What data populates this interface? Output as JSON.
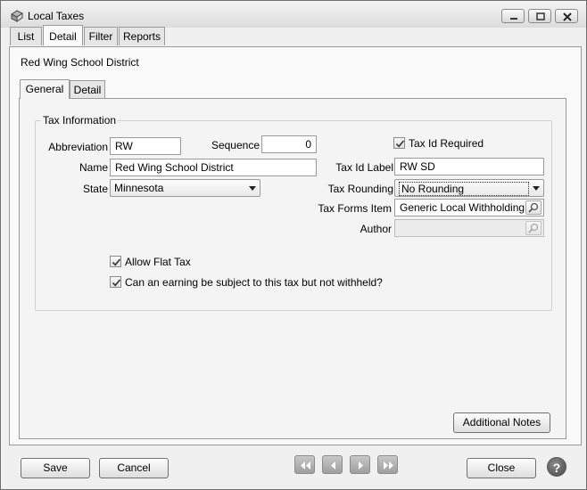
{
  "window": {
    "title": "Local Taxes"
  },
  "main_tabs": [
    {
      "label": "List"
    },
    {
      "label": "Detail"
    },
    {
      "label": "Filter"
    },
    {
      "label": "Reports"
    }
  ],
  "record_title": "Red Wing School District",
  "sub_tabs": [
    {
      "label": "General"
    },
    {
      "label": "Detail"
    }
  ],
  "tax_info": {
    "legend": "Tax Information",
    "abbreviation_label": "Abbreviation",
    "abbreviation_value": "RW",
    "sequence_label": "Sequence",
    "sequence_value": "0",
    "name_label": "Name",
    "name_value": "Red Wing School District",
    "state_label": "State",
    "state_value": "Minnesota",
    "tax_id_required_label": "Tax Id Required",
    "tax_id_required_checked": true,
    "tax_id_label_label": "Tax Id Label",
    "tax_id_label_value": "RW SD",
    "tax_rounding_label": "Tax Rounding",
    "tax_rounding_value": "No Rounding",
    "tax_forms_item_label": "Tax Forms Item",
    "tax_forms_item_value": "Generic Local Withholding",
    "author_label": "Author",
    "author_value": "",
    "allow_flat_tax_label": "Allow Flat Tax",
    "allow_flat_tax_checked": true,
    "earning_subject_label": "Can an earning be subject to this tax but not withheld?",
    "earning_subject_checked": true
  },
  "buttons": {
    "additional_notes": "Additional Notes",
    "save": "Save",
    "cancel": "Cancel",
    "close": "Close",
    "help": "?"
  },
  "icons": {
    "app": "app-icon",
    "minimize": "minimize-icon",
    "maximize": "maximize-icon",
    "close": "close-icon",
    "first": "first-record-icon",
    "prev": "previous-record-icon",
    "next": "next-record-icon",
    "last": "last-record-icon",
    "lookup": "magnifier-icon",
    "dropdown": "chevron-down-icon"
  }
}
